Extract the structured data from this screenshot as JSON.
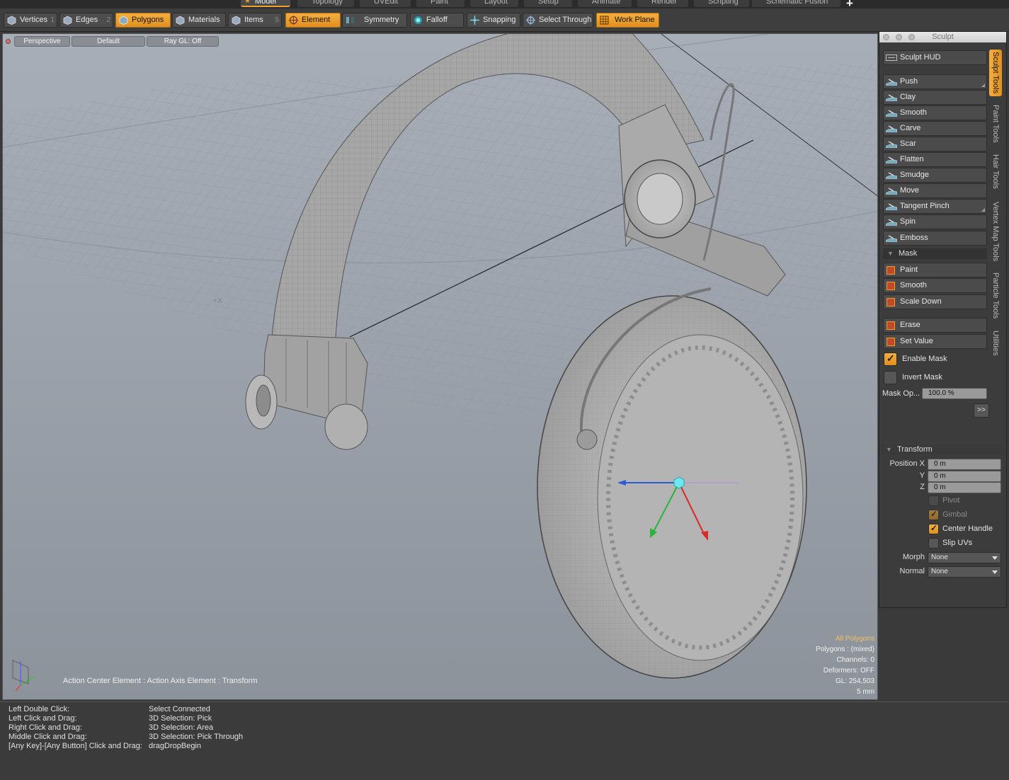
{
  "layout_tabs": [
    "Model",
    "Topology",
    "UVEdit",
    "Paint",
    "Layout",
    "Setup",
    "Animate",
    "Render",
    "Scripting",
    "Schematic Fusion"
  ],
  "toolbar": {
    "vertices": {
      "label": "Vertices",
      "num": "1"
    },
    "edges": {
      "label": "Edges",
      "num": "2"
    },
    "polygons": {
      "label": "Polygons",
      "num": ""
    },
    "materials": {
      "label": "Materials"
    },
    "items": {
      "label": "Items",
      "num": "5"
    },
    "element": "Element",
    "symmetry": "Symmetry",
    "falloff": "Falloff",
    "snapping": "Snapping",
    "select_through": "Select Through",
    "work_plane": "Work Plane"
  },
  "viewport": {
    "view": "Perspective",
    "style": "Default",
    "raygl": "Ray GL: Off",
    "axis_label": "+X",
    "action_text": "Action Center Element : Action Axis Element : Transform",
    "stats": {
      "all_polygons": "All Polygons",
      "polygons": "Polygons : (mixed)",
      "channels": "Channels: 0",
      "deformers": "Deformers: OFF",
      "gl": "GL: 254,503",
      "scale": "5 mm"
    }
  },
  "sculpt": {
    "title": "Sculpt",
    "hud": "Sculpt HUD",
    "tools": [
      "Push",
      "Clay",
      "Smooth",
      "Carve",
      "Scar",
      "Flatten",
      "Smudge",
      "Move",
      "Tangent Pinch",
      "Spin",
      "Emboss"
    ],
    "mask_header": "Mask",
    "mask_tools": [
      "Paint",
      "Smooth",
      "Scale Down"
    ],
    "erase": "Erase",
    "set_value": "Set Value",
    "enable_mask": "Enable Mask",
    "invert_mask": "Invert Mask",
    "mask_op_label": "Mask Op...",
    "mask_op_value": "100.0 %",
    "more": ">>",
    "vertical_tabs": [
      "Sculpt Tools",
      "Paint Tools",
      "Hair Tools",
      "Vertex Map Tools",
      "Particle Tools",
      "Utilities"
    ]
  },
  "transform": {
    "header": "Transform",
    "position_x_label": "Position X",
    "y_label": "Y",
    "z_label": "Z",
    "x": "0 m",
    "y": "0 m",
    "z": "0 m",
    "pivot": "Pivot",
    "gimbal": "Gimbal",
    "center_handle": "Center Handle",
    "slip_uvs": "Slip UVs",
    "morph_label": "Morph",
    "morph_value": "None",
    "normal_label": "Normal",
    "normal_value": "None"
  },
  "info": [
    {
      "action": "Left Double Click:",
      "result": "Select Connected"
    },
    {
      "action": "Left Click and Drag:",
      "result": "3D Selection: Pick"
    },
    {
      "action": "Right Click and Drag:",
      "result": "3D Selection: Area"
    },
    {
      "action": "Middle Click and Drag:",
      "result": "3D Selection: Pick Through"
    },
    {
      "action": "[Any Key]-[Any Button] Click and Drag:",
      "result": "dragDropBegin"
    }
  ],
  "colors": {
    "accent": "#f0a030",
    "viewport_bg": "#9da4ad",
    "panel_bg": "#3c3c3c"
  }
}
